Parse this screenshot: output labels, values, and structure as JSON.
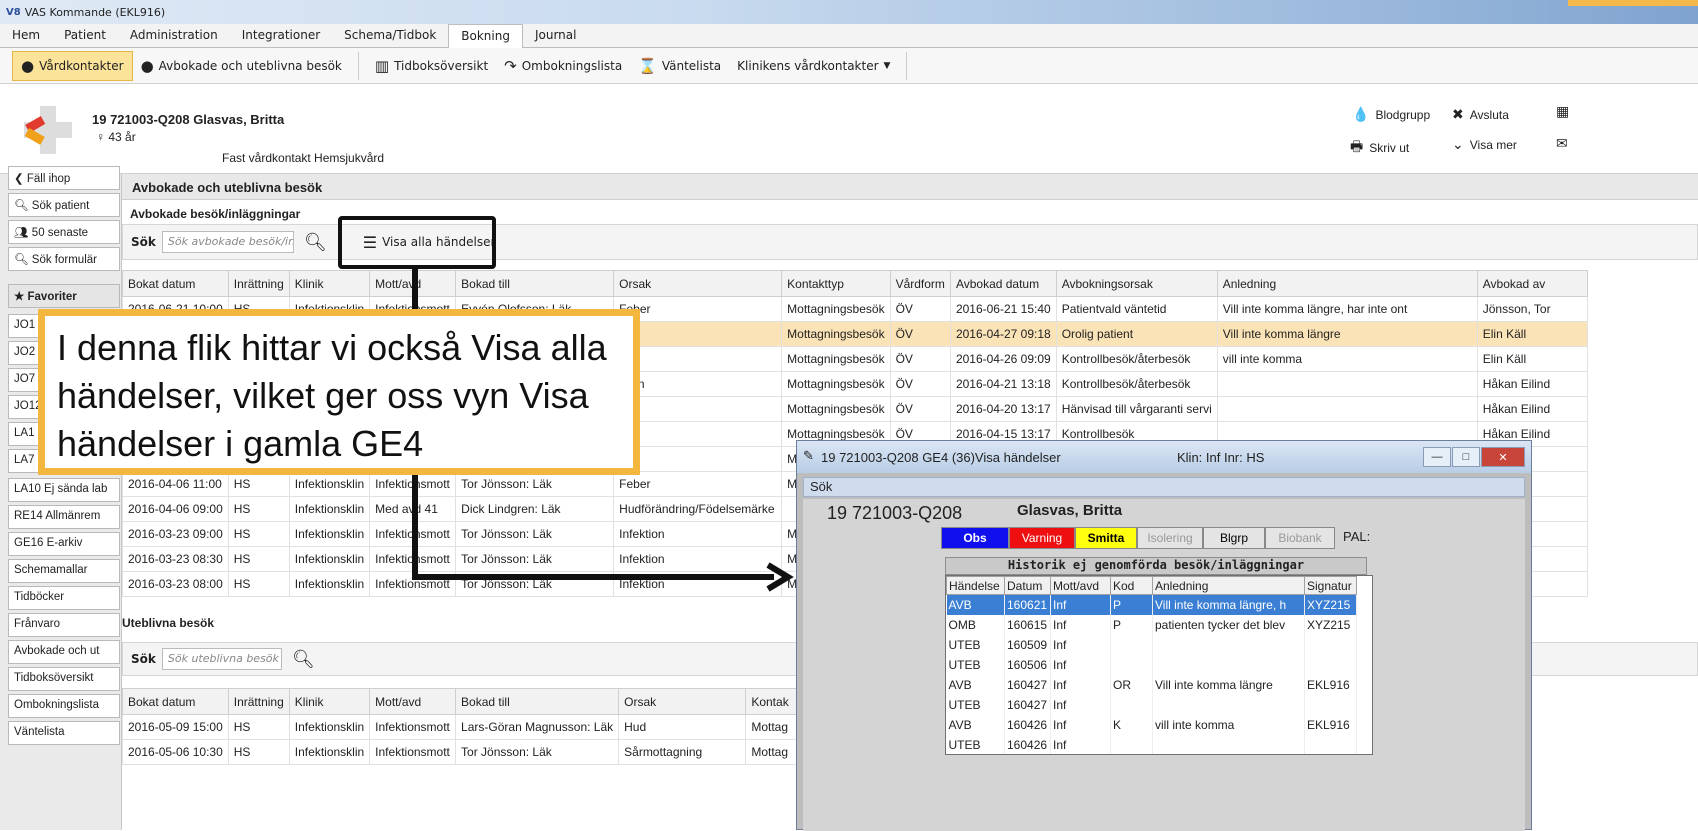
{
  "window": {
    "title": "VAS Kommande (EKL916)",
    "logo": "vas"
  },
  "menu": [
    "Hem",
    "Patient",
    "Administration",
    "Integrationer",
    "Schema/Tidbok",
    "Bokning",
    "Journal"
  ],
  "toolbar": {
    "vardkontakter": "Vårdkontakter",
    "avbokade": "Avbokade och uteblivna besök",
    "tidboksoversikt": "Tidboksöversikt",
    "ombokningslista": "Ombokningslista",
    "vantelista": "Väntelista",
    "kliniken": "Klinikens vårdkontakter"
  },
  "patient": {
    "name": "19 721003-Q208 Glasvas, Britta",
    "age": "♀ 43 år",
    "info": "Fast vårdkontakt  Hemsjukvård",
    "blodgrupp": "Blodgrupp",
    "avsluta": "Avsluta",
    "skriv_ut": "Skriv ut",
    "visa_mer": "Visa mer"
  },
  "sidebar": {
    "fall_ihop": "Fäll ihop",
    "sok_patient": "Sök patient",
    "senaste": "50 senaste",
    "sok_formular": "Sök formulär",
    "favoriter": "Favoriter",
    "items": [
      "JO1",
      "JO2",
      "JO7",
      "JO12",
      "LA1",
      "LA7",
      "LA10 Ej sända lab",
      "RE14 Allmänrem",
      "GE16 E-arkiv",
      "Schemamallar",
      "Tidböcker",
      "Frånvaro",
      "Avbokade och ut",
      "Tidboksöversikt",
      "Ombokningslista",
      "Väntelista"
    ]
  },
  "main": {
    "title": "Avbokade och uteblivna besök",
    "section1": "Avbokade besök/inläggningar",
    "search_label": "Sök",
    "search_placeholder1": "Sök avbokade besök/in",
    "visa_alla": "Visa alla händelser",
    "columns1": [
      "Bokat datum",
      "Inrättning",
      "Klinik",
      "Mott/avd",
      "Bokad till",
      "Orsak",
      "Kontakttyp",
      "Vårdform",
      "Avbokad datum",
      "Avbokningsorsak",
      "Anledning",
      "Avbokad av"
    ],
    "rows1": [
      [
        "2016-06-21 10:00",
        "HS",
        "Infektionsklin",
        "Infektionsmott",
        "Evyén Olofsson: Läk",
        "Feber",
        "Mottagningsbesök",
        "ÖV",
        "2016-06-21 15:40",
        "Patientvald väntetid",
        "Vill inte komma längre, har inte ont",
        "Jönsson, Tor"
      ],
      [
        "",
        "",
        "",
        "",
        "",
        "r",
        "Mottagningsbesök",
        "ÖV",
        "2016-04-27 09:18",
        "Orolig patient",
        "Vill inte komma längre",
        "Elin Käll"
      ],
      [
        "",
        "",
        "",
        "",
        "",
        "r",
        "Mottagningsbesök",
        "ÖV",
        "2016-04-26 09:09",
        "Kontrollbesök/återbesök",
        "vill inte komma",
        "Elin Käll"
      ],
      [
        "",
        "",
        "",
        "",
        "",
        "ktion",
        "Mottagningsbesök",
        "ÖV",
        "2016-04-21 13:18",
        "Kontrollbesök/återbesök",
        "",
        "Håkan Eilind"
      ],
      [
        "",
        "",
        "",
        "",
        "",
        "r",
        "Mottagningsbesök",
        "ÖV",
        "2016-04-20 13:17",
        "Hänvisad till vårgaranti servi",
        "",
        "Håkan Eilind"
      ],
      [
        "",
        "",
        "",
        "",
        "",
        "",
        "Mottagningsbesök",
        "ÖV",
        "2016-04-15 13:17",
        "Kontrollbesök",
        "",
        "Håkan Eilind"
      ],
      [
        "",
        "",
        "",
        "",
        "",
        "",
        "Mo",
        "",
        "",
        "",
        "",
        ""
      ],
      [
        "2016-04-06 11:00",
        "HS",
        "Infektionsklin",
        "Infektionsmott",
        "Tor Jönsson: Läk",
        "Feber",
        "Mo",
        "",
        "",
        "",
        "",
        ""
      ],
      [
        "2016-04-06 09:00",
        "HS",
        "Infektionsklin",
        "Med avd 41",
        "Dick Lindgren: Läk",
        "Hudförändring/Födelsemärke",
        "",
        "",
        "",
        "",
        "",
        ""
      ],
      [
        "2016-03-23 09:00",
        "HS",
        "Infektionsklin",
        "Infektionsmott",
        "Tor Jönsson: Läk",
        "Infektion",
        "Mo",
        "",
        "",
        "",
        "",
        ""
      ],
      [
        "2016-03-23 08:30",
        "HS",
        "Infektionsklin",
        "Infektionsmott",
        "Tor Jönsson: Läk",
        "Infektion",
        "Mo",
        "",
        "",
        "",
        "",
        ""
      ],
      [
        "2016-03-23 08:00",
        "HS",
        "Infektionsklin",
        "Infektionsmott",
        "Tor Jönsson: Läk",
        "Infektion",
        "Mo",
        "",
        "",
        "",
        "",
        ""
      ]
    ],
    "section2": "Uteblivna besök",
    "search_placeholder2": "Sök uteblivna besök",
    "columns2": [
      "Bokat datum",
      "Inrättning",
      "Klinik",
      "Mott/avd",
      "Bokad till",
      "Orsak",
      "Kontak"
    ],
    "rows2": [
      [
        "2016-05-09 15:00",
        "HS",
        "Infektionsklin",
        "Infektionsmott",
        "Lars-Göran Magnusson: Läk",
        "Hud",
        "Mottag"
      ],
      [
        "2016-05-06 10:30",
        "HS",
        "Infektionsklin",
        "Infektionsmott",
        "Tor Jönsson: Läk",
        "Sårmottagning",
        "Mottag"
      ]
    ]
  },
  "callout": {
    "text": "I denna flik hittar vi också Visa alla händelser, vilket ger oss vyn Visa händelser i gamla GE4",
    "border_color": "#f3b63f"
  },
  "dialog": {
    "title": "19 721003-Q208  GE4 (36)Visa händelser",
    "klin": "Klin: Inf  Inr: HS",
    "menu": "Sök",
    "pnr": "19 721003-Q208",
    "pname": "Glasvas, Britta",
    "flags": {
      "obs": "Obs",
      "varning": "Varning",
      "smitta": "Smitta",
      "isolering": "Isolering",
      "blgrp": "Blgrp",
      "biobank": "Biobank",
      "pal": "PAL:"
    },
    "history_title": "Historik ej genomförda besök/inläggningar",
    "columns": [
      "Händelse",
      "Datum",
      "Mott/avd",
      "Kod",
      "Anledning",
      "Signatur"
    ],
    "rows": [
      [
        "AVB",
        "160621",
        "Inf",
        "P",
        "Vill inte komma längre, h",
        "XYZ215"
      ],
      [
        "OMB",
        "160615",
        "Inf",
        "P",
        "patienten tycker det blev",
        "XYZ215"
      ],
      [
        "UTEB",
        "160509",
        "Inf",
        "",
        "",
        ""
      ],
      [
        "UTEB",
        "160506",
        "Inf",
        "",
        "",
        ""
      ],
      [
        "AVB",
        "160427",
        "Inf",
        "OR",
        "Vill inte komma längre",
        "EKL916"
      ],
      [
        "UTEB",
        "160427",
        "Inf",
        "",
        "",
        ""
      ],
      [
        "AVB",
        "160426",
        "Inf",
        "K",
        "vill inte komma",
        "EKL916"
      ],
      [
        "UTEB",
        "160426",
        "Inf",
        "",
        "",
        ""
      ]
    ]
  }
}
